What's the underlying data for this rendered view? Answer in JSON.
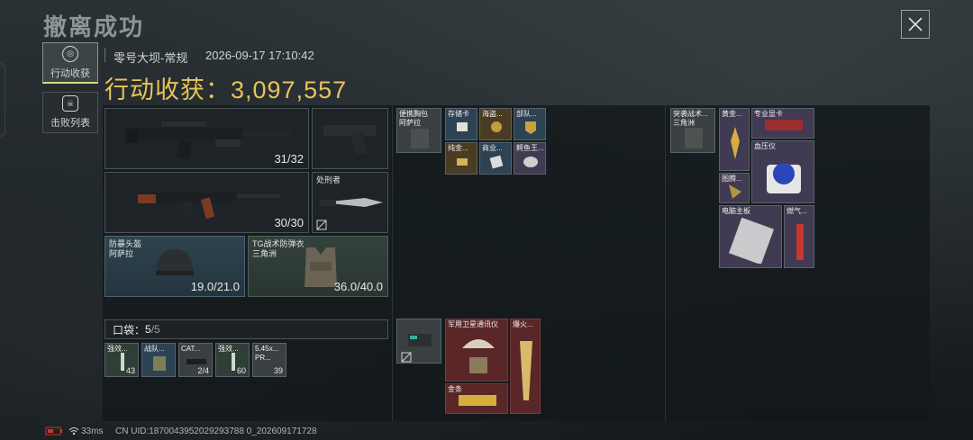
{
  "header": {
    "title": "撤离成功",
    "map": "零号大坝-常规",
    "datetime": "2026-09-17 17:10:42",
    "loot_label": "行动收获：",
    "loot_value": "3,097,557"
  },
  "sidebar": {
    "tabs": [
      {
        "label": "行动收获",
        "icon": "target-icon",
        "active": true
      },
      {
        "label": "击败列表",
        "icon": "skull-icon",
        "active": false
      }
    ]
  },
  "equipment": {
    "primary_weapon": {
      "ammo": "31/32",
      "icon": "rifle-icon"
    },
    "pistol": {
      "icon": "pistol-icon"
    },
    "secondary_weapon": {
      "ammo": "30/30",
      "icon": "ak-rifle-icon"
    },
    "melee": {
      "label": "处刑者",
      "icon": "knife-icon"
    },
    "helmet": {
      "name": "防暴头盔",
      "sub": "阿萨拉",
      "durability": "19.0/21.0"
    },
    "vest": {
      "name": "TG战术防弹衣",
      "sub": "三角洲",
      "durability": "36.0/40.0"
    }
  },
  "pocket": {
    "label": "口袋：",
    "count": "5",
    "capacity": "/5",
    "items": [
      {
        "label": "强效...",
        "count": "43"
      },
      {
        "label": "战队...",
        "count": ""
      },
      {
        "label": "CAT...",
        "count": "2/4"
      },
      {
        "label": "强效...",
        "count": "60"
      },
      {
        "label": "5.45x...",
        "sub": "PR...",
        "count": "39"
      }
    ]
  },
  "chest_rig": {
    "name": "便携胸包",
    "sub": "阿萨拉",
    "items": [
      {
        "label": "存储卡"
      },
      {
        "label": "海盗..."
      },
      {
        "label": "部队..."
      },
      {
        "label": "纯金..."
      },
      {
        "label": "商业..."
      },
      {
        "label": "鳄鱼王..."
      }
    ]
  },
  "backpack": {
    "items": [
      {
        "label": "军用卫星通讯仪"
      },
      {
        "label": "爆火..."
      },
      {
        "label": "金条"
      }
    ]
  },
  "bag": {
    "name": "突袭战术...",
    "sub": "三角洲",
    "items": [
      {
        "label": "黄金..."
      },
      {
        "label": "专业显卡"
      },
      {
        "label": "血压仪"
      },
      {
        "label": "图腾..."
      },
      {
        "label": "电脑主板"
      },
      {
        "label": "燃气..."
      }
    ]
  },
  "status": {
    "ping": "33ms",
    "uid": "CN UID:1870043952029293788 0_202609171728"
  },
  "colors": {
    "accent_gold": "#e8c35a",
    "rare_blue": "#2d4252",
    "epic_purple": "#403a52",
    "legend_red": "#5a2628"
  }
}
